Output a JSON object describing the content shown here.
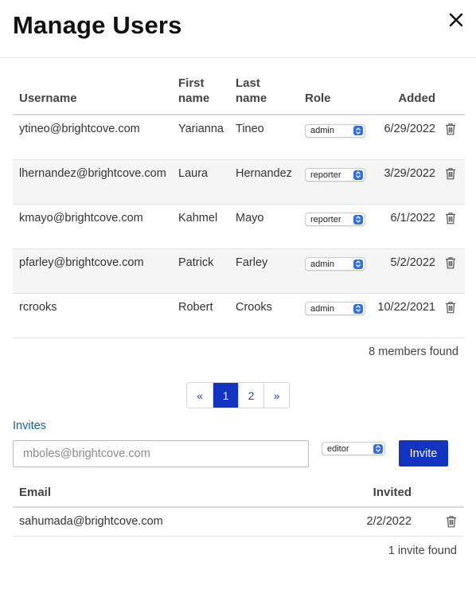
{
  "dialog": {
    "title": "Manage Users"
  },
  "users_table": {
    "headers": {
      "username": "Username",
      "first_name": "First name",
      "last_name": "Last name",
      "role": "Role",
      "added": "Added"
    },
    "rows": [
      {
        "username": "ytineo@brightcove.com",
        "first_name": "Yarianna",
        "last_name": "Tineo",
        "role": "admin",
        "added": "6/29/2022"
      },
      {
        "username": "lhernandez@brightcove.com",
        "first_name": "Laura",
        "last_name": "Hernandez",
        "role": "reporter",
        "added": "3/29/2022"
      },
      {
        "username": "kmayo@brightcove.com",
        "first_name": "Kahmel",
        "last_name": "Mayo",
        "role": "reporter",
        "added": "6/1/2022"
      },
      {
        "username": "pfarley@brightcove.com",
        "first_name": "Patrick",
        "last_name": "Farley",
        "role": "admin",
        "added": "5/2/2022"
      },
      {
        "username": "rcrooks",
        "first_name": "Robert",
        "last_name": "Crooks",
        "role": "admin",
        "added": "10/22/2021"
      }
    ],
    "count_text": "8 members found"
  },
  "pagination": {
    "prev": "«",
    "pages": [
      "1",
      "2"
    ],
    "current": "1",
    "next": "»"
  },
  "invites": {
    "label": "Invites",
    "email_placeholder": "mboles@brightcove.com",
    "role": "editor",
    "invite_button": "Invite",
    "headers": {
      "email": "Email",
      "invited": "Invited"
    },
    "rows": [
      {
        "email": "sahumada@brightcove.com",
        "invited": "2/2/2022"
      }
    ],
    "count_text": "1 invite found"
  },
  "colors": {
    "primary": "#1234c0",
    "link": "#1c5f95",
    "select_accent": "#2f6fe0"
  },
  "icons": {
    "close": "close-icon",
    "delete": "trash-icon",
    "select": "chevron-updown-icon"
  }
}
